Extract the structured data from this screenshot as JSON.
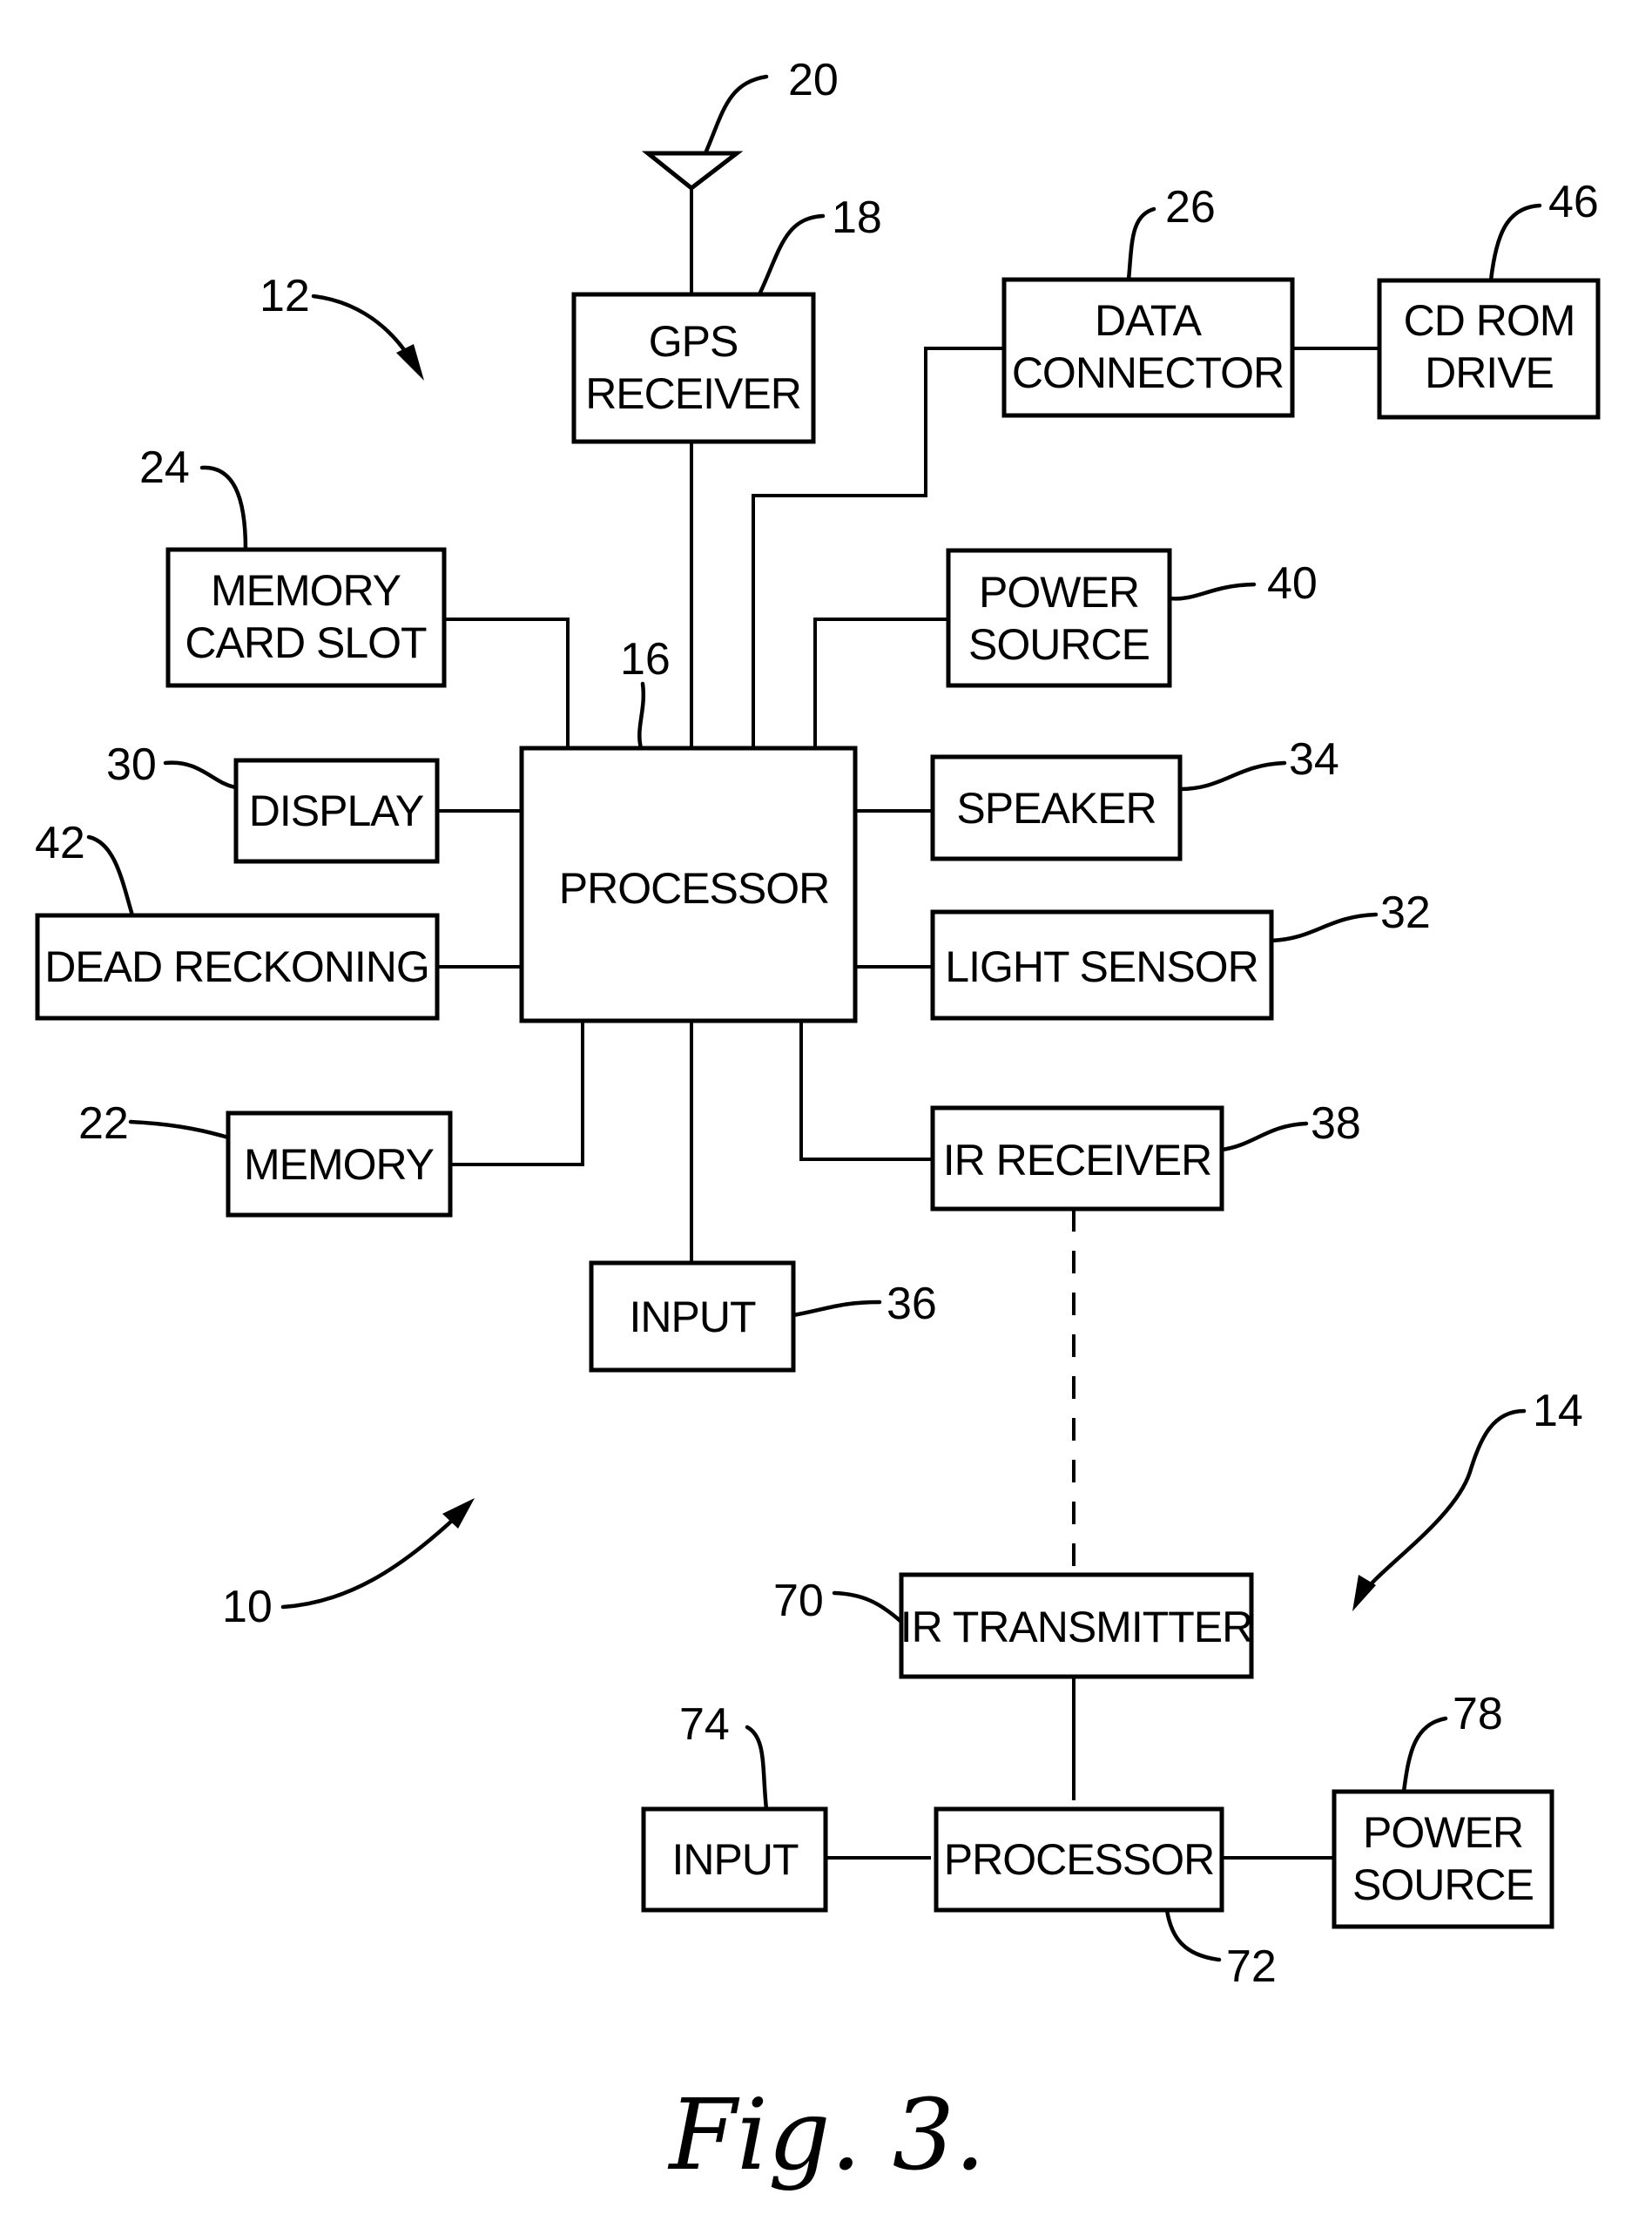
{
  "figure": {
    "caption": "Fig. 3.",
    "system_ref": "10",
    "unit_refs": {
      "main_unit": "12",
      "remote_unit": "14"
    }
  },
  "blocks": {
    "gps_receiver": {
      "lines": [
        "GPS",
        "RECEIVER"
      ],
      "ref": "18"
    },
    "antenna": {
      "ref": "20"
    },
    "data_connector": {
      "lines": [
        "DATA",
        "CONNECTOR"
      ],
      "ref": "26"
    },
    "cd_rom_drive": {
      "lines": [
        "CD ROM",
        "DRIVE"
      ],
      "ref": "46"
    },
    "memory_card_slot": {
      "lines": [
        "MEMORY",
        "CARD SLOT"
      ],
      "ref": "24"
    },
    "power_source_main": {
      "lines": [
        "POWER",
        "SOURCE"
      ],
      "ref": "40"
    },
    "processor_main": {
      "lines": [
        "PROCESSOR"
      ],
      "ref": "16"
    },
    "display": {
      "lines": [
        "DISPLAY"
      ],
      "ref": "30"
    },
    "speaker": {
      "lines": [
        "SPEAKER"
      ],
      "ref": "34"
    },
    "dead_reckoning": {
      "lines": [
        "DEAD RECKONING"
      ],
      "ref": "42"
    },
    "light_sensor": {
      "lines": [
        "LIGHT SENSOR"
      ],
      "ref": "32"
    },
    "memory": {
      "lines": [
        "MEMORY"
      ],
      "ref": "22"
    },
    "ir_receiver": {
      "lines": [
        "IR RECEIVER"
      ],
      "ref": "38"
    },
    "input_main": {
      "lines": [
        "INPUT"
      ],
      "ref": "36"
    },
    "ir_transmitter": {
      "lines": [
        "IR TRANSMITTER"
      ],
      "ref": "70"
    },
    "input_remote": {
      "lines": [
        "INPUT"
      ],
      "ref": "74"
    },
    "processor_remote": {
      "lines": [
        "PROCESSOR"
      ],
      "ref": "72"
    },
    "power_source_remote": {
      "lines": [
        "POWER",
        "SOURCE"
      ],
      "ref": "78"
    }
  }
}
